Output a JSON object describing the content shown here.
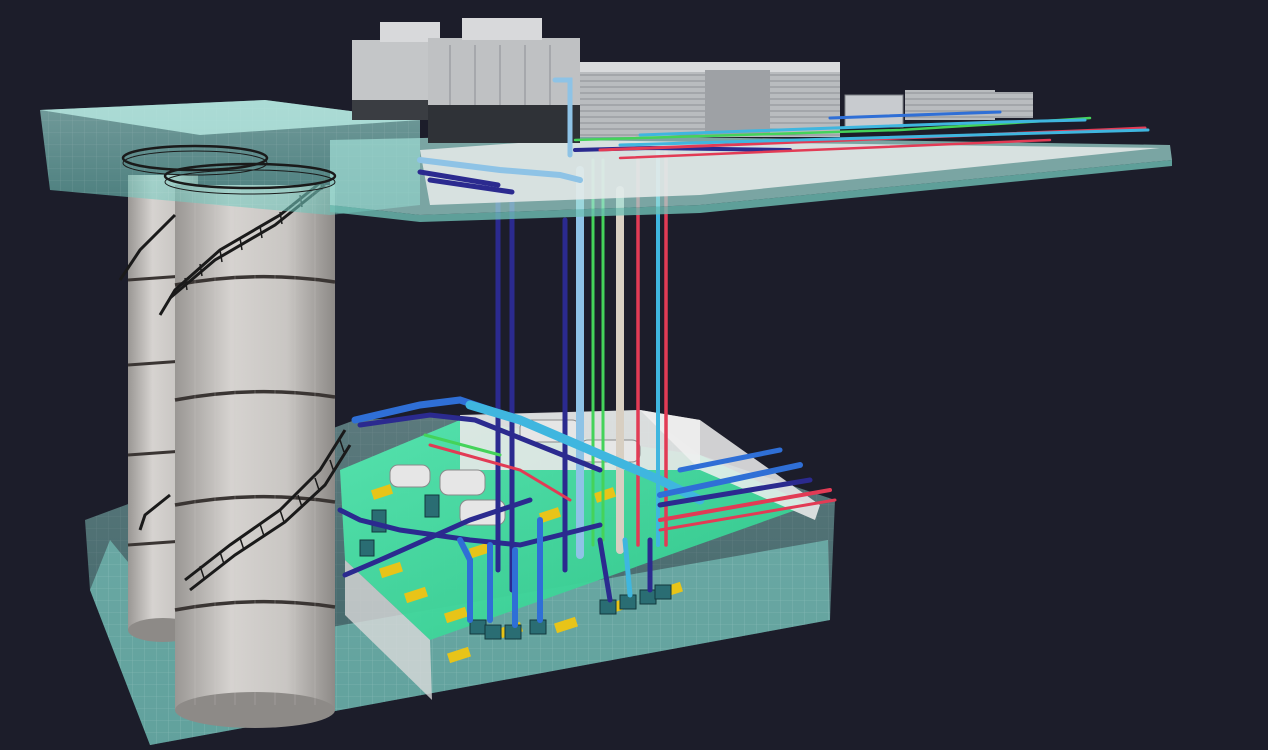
{
  "scene": {
    "description_visible_text": "",
    "background_color": "#1c1d2a",
    "colors": {
      "glass": "#8fd8cf",
      "equipment_floor": "#3fe0a0",
      "tank_body": "#c9c6c3",
      "tank_band": "#3a3533",
      "pipe_navy": "#2b2a8f",
      "pipe_blue": "#2f6fd6",
      "pipe_cyan": "#3fb6df",
      "pipe_light_blue": "#8ec3e6",
      "pipe_red": "#e23b55",
      "pipe_green": "#44d35a",
      "pipe_beige": "#d8cfc2",
      "cooling_tower": "#c4c6c8",
      "yellow_marking": "#e8c418"
    },
    "components": [
      "roof-slab",
      "cooling-tower",
      "air-cooled-unit",
      "water-tank",
      "storage-tank",
      "spiral-staircase",
      "basement-plant-room",
      "pump",
      "riser-pipe"
    ]
  }
}
